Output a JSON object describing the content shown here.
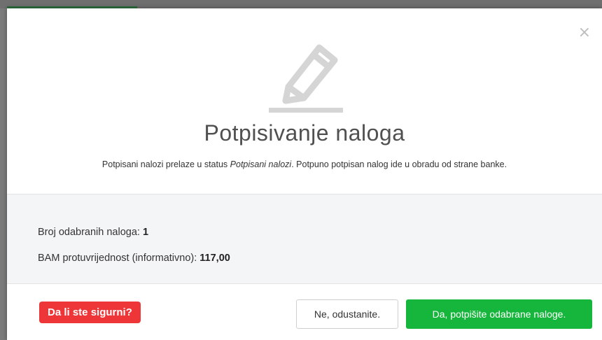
{
  "modal": {
    "close_glyph": "×",
    "title": "Potpisivanje naloga",
    "subtitle_prefix": "Potpisani nalozi prelaze u status ",
    "subtitle_status": "Potpisani nalozi",
    "subtitle_suffix": ". Potpuno potpisan nalog ide u obradu od strane banke.",
    "icon": "pencil-icon"
  },
  "info": {
    "count_label": "Broj odabranih naloga: ",
    "count_value": "1",
    "amount_label": "BAM protuvrijednost (informativno): ",
    "amount_value": "117,00"
  },
  "footer": {
    "warning": "Da li ste sigurni?",
    "cancel_label": "Ne, odustanite.",
    "confirm_label": "Da, potpišite odabrane naloge."
  },
  "colors": {
    "confirm": "#16b53b",
    "warning": "#ee3538",
    "icon": "#d5d5d5"
  }
}
